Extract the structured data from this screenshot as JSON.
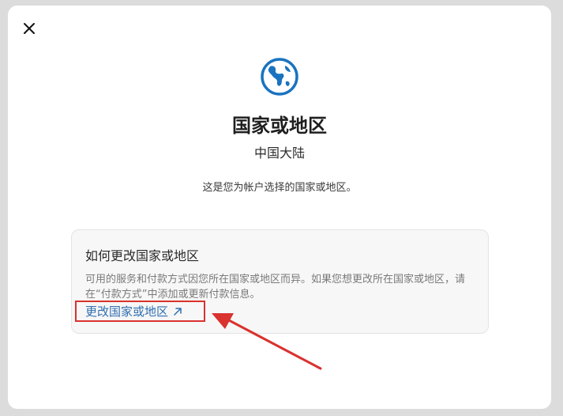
{
  "modal": {
    "title": "国家或地区",
    "region": "中国大陆",
    "description": "这是您为帐户选择的国家或地区。",
    "close_icon": "close-icon",
    "globe_icon": "globe-icon"
  },
  "card": {
    "title": "如何更改国家或地区",
    "body": "可用的服务和付款方式因您所在国家或地区而异。如果您想更改所在国家或地区，请在“付款方式”中添加或更新付款信息。",
    "link_label": "更改国家或地区",
    "link_icon": "external-arrow-icon"
  },
  "colors": {
    "accent": "#1a73c0",
    "link": "#2f6fb0",
    "annotation": "#d9322f"
  }
}
